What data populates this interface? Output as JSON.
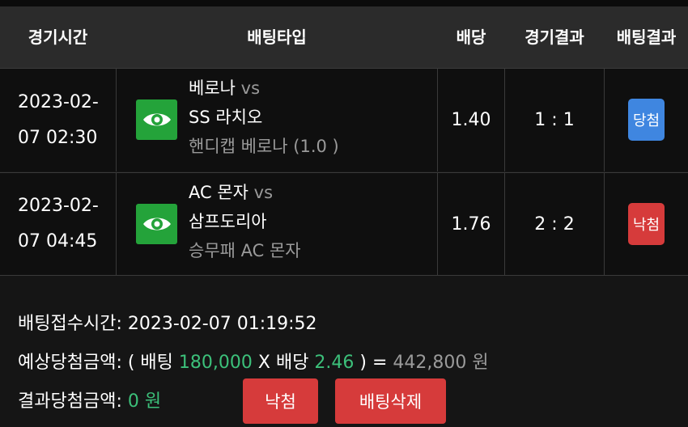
{
  "header": {
    "time": "경기시간",
    "bet_type": "배팅타입",
    "odds": "배당",
    "game_result": "경기결과",
    "bet_result": "배팅결과"
  },
  "rows": [
    {
      "date": "2023-02-",
      "time": "07 02:30",
      "icon": "eye-icon",
      "team1": "베로나",
      "vs": "vs",
      "team2": "SS 라치오",
      "market": "핸디캡 베로나 (1.0 )",
      "odds": "1.40",
      "score": "1 : 1",
      "result": "당첨",
      "result_color": "#3f86e0"
    },
    {
      "date": "2023-02-",
      "time": "07 04:45",
      "icon": "eye-icon",
      "team1": "AC 몬자",
      "vs": "vs",
      "team2": "삼프도리아",
      "market": "승무패 AC 몬자",
      "odds": "1.76",
      "score": "2 : 2",
      "result": "낙첨",
      "result_color": "#d63b3b"
    }
  ],
  "summary": {
    "accepted_label": "배팅접수시간: ",
    "accepted_time": "2023-02-07 01:19:52",
    "expected_label": "예상당첨금액: ( 배팅 ",
    "stake": "180,000",
    "x_label": " X 배당 ",
    "total_odds": "2.46",
    "eq_label": " ) = ",
    "expected_amount": "442,800 원",
    "final_label": "결과당첨금액: ",
    "final_amount": "0 원"
  },
  "buttons": {
    "status": "낙첨",
    "delete": "배팅삭제"
  },
  "colors": {
    "win": "#3f86e0",
    "lose": "#d63b3b",
    "accent_green": "#3cc07a",
    "eye_box": "#24a33a"
  }
}
